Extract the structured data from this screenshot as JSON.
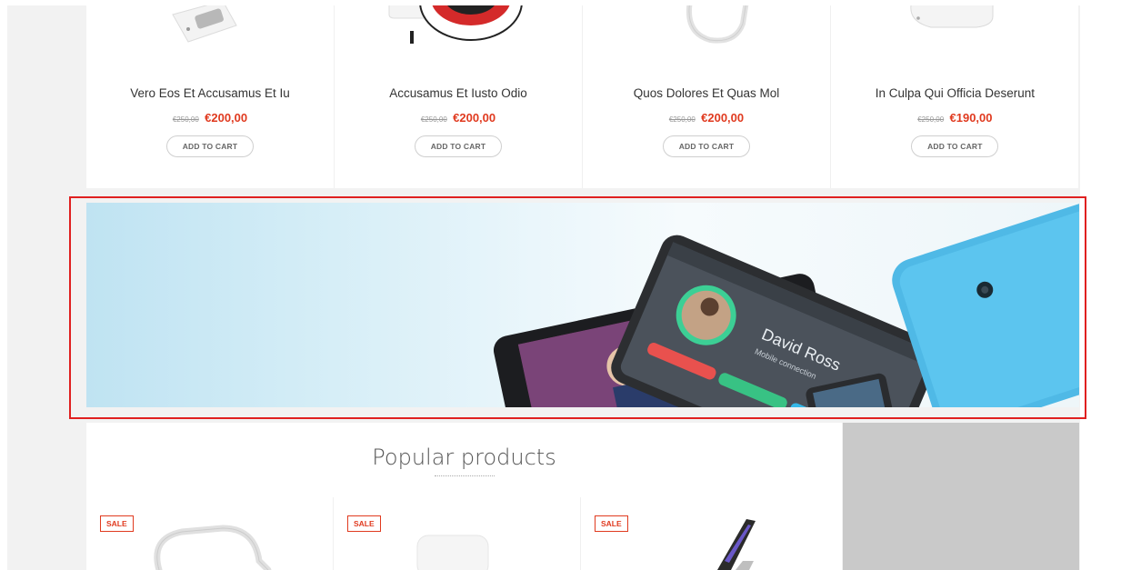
{
  "top_products": [
    {
      "name": "Vero Eos Et Accusamus Et Iu",
      "old_price": "€250,00",
      "price": "€200,00",
      "cart_label": "ADD TO CART"
    },
    {
      "name": "Accusamus Et Iusto Odio",
      "old_price": "€250,00",
      "price": "€200,00",
      "cart_label": "ADD TO CART"
    },
    {
      "name": "Quos Dolores Et Quas Mol",
      "old_price": "€250,00",
      "price": "€200,00",
      "cart_label": "ADD TO CART"
    },
    {
      "name": "In Culpa Qui Officia Deserunt",
      "old_price": "€250,00",
      "price": "€190,00",
      "cart_label": "ADD TO CART"
    }
  ],
  "banner": {
    "contact_name": "David Ross",
    "contact_subtitle": "Mobile connection"
  },
  "popular": {
    "title": "Popular products",
    "items": [
      {
        "badge": "SALE"
      },
      {
        "badge": "SALE"
      },
      {
        "badge": "SALE"
      }
    ]
  },
  "colors": {
    "price_red": "#e03a1f",
    "highlight_border": "#e02020",
    "tablet_blue": "#4fb9e6",
    "sidebar_gray": "#c9c9c9"
  }
}
